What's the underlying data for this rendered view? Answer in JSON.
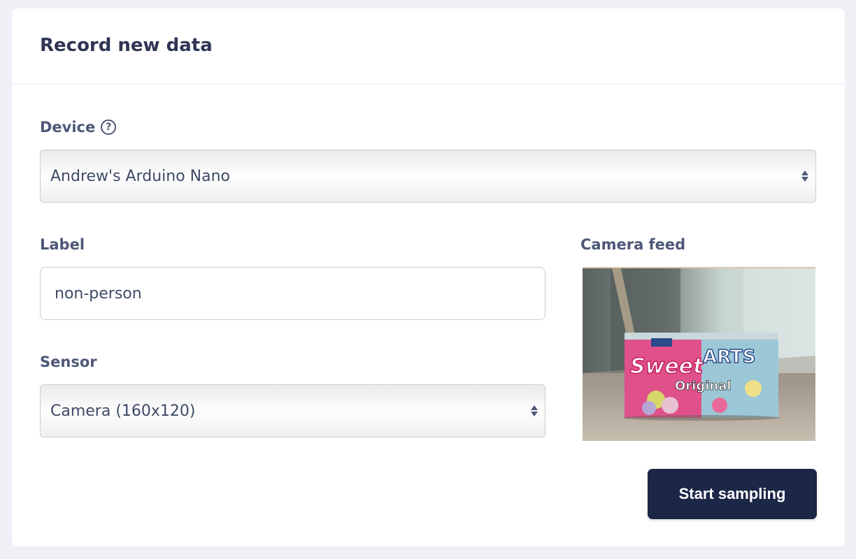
{
  "card": {
    "title": "Record new data"
  },
  "device": {
    "label": "Device",
    "help_icon": "question-circle-icon",
    "selected": "Andrew's Arduino Nano"
  },
  "label_field": {
    "label": "Label",
    "value": "non-person"
  },
  "sensor": {
    "label": "Sensor",
    "selected": "Camera (160x120)"
  },
  "camera": {
    "label": "Camera feed"
  },
  "actions": {
    "start_label": "Start sampling"
  },
  "colors": {
    "primary_button": "#1c2747",
    "page_background": "#eef0f5",
    "card_background": "#ffffff"
  }
}
